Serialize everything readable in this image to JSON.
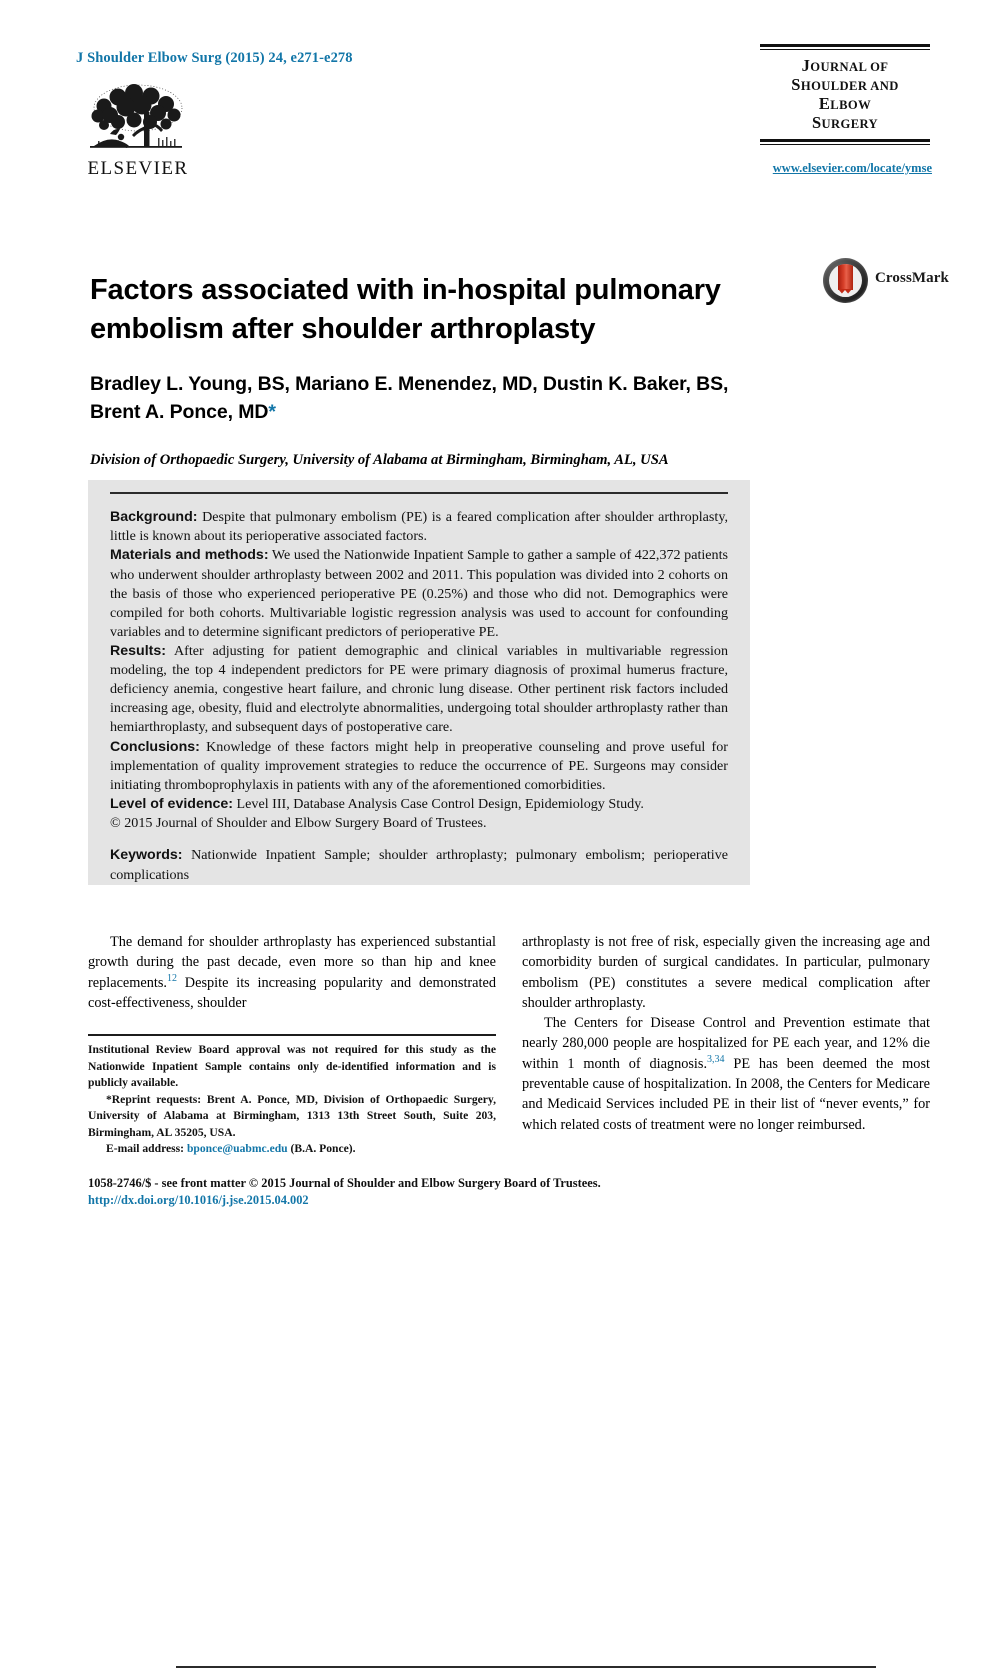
{
  "header": {
    "journal_ref": "J Shoulder Elbow Surg (2015) 24, e271-e278",
    "publisher_name": "ELSEVIER",
    "masthead": {
      "line1_first": "J",
      "line1_rest": "OURNAL OF",
      "line2_first": "S",
      "line2_rest": "HOULDER AND",
      "line3_first": "E",
      "line3_rest": "LBOW",
      "line4_first": "S",
      "line4_rest": "URGERY"
    },
    "journal_url": "www.elsevier.com/locate/ymse"
  },
  "article": {
    "title": "Factors associated with in-hospital pulmonary embolism after shoulder arthroplasty",
    "authors_line1": "Bradley L. Young, BS, Mariano E. Menendez, MD, Dustin K. Baker, BS,",
    "authors_line2": "Brent A. Ponce, MD",
    "corresponding_marker": "*",
    "affiliation": "Division of Orthopaedic Surgery, University of Alabama at Birmingham, Birmingham, AL, USA",
    "crossmark_label": "CrossMark"
  },
  "abstract": {
    "background_label": "Background:",
    "background_text": " Despite that pulmonary embolism (PE) is a feared complication after shoulder arthroplasty, little is known about its perioperative associated factors.",
    "methods_label": "Materials and methods:",
    "methods_text": " We used the Nationwide Inpatient Sample to gather a sample of 422,372 patients who underwent shoulder arthroplasty between 2002 and 2011. This population was divided into 2 cohorts on the basis of those who experienced perioperative PE (0.25%) and those who did not. Demographics were compiled for both cohorts. Multivariable logistic regression analysis was used to account for confounding variables and to determine significant predictors of perioperative PE.",
    "results_label": "Results:",
    "results_text": " After adjusting for patient demographic and clinical variables in multivariable regression modeling, the top 4 independent predictors for PE were primary diagnosis of proximal humerus fracture, deficiency anemia, congestive heart failure, and chronic lung disease. Other pertinent risk factors included increasing age, obesity, fluid and electrolyte abnormalities, undergoing total shoulder arthroplasty rather than hemiarthroplasty, and subsequent days of postoperative care.",
    "conclusions_label": "Conclusions:",
    "conclusions_text": " Knowledge of these factors might help in preoperative counseling and prove useful for implementation of quality improvement strategies to reduce the occurrence of PE. Surgeons may consider initiating thromboprophylaxis in patients with any of the aforementioned comorbidities.",
    "evidence_label": "Level of evidence:",
    "evidence_text": " Level III, Database Analysis Case Control Design, Epidemiology Study.",
    "copyright": "© 2015 Journal of Shoulder and Elbow Surgery Board of Trustees.",
    "keywords_label": "Keywords:",
    "keywords_text": " Nationwide Inpatient Sample; shoulder arthroplasty; pulmonary embolism; perioperative complications"
  },
  "body": {
    "left_col": {
      "para1_a": "The demand for shoulder arthroplasty has experienced substantial growth during the past decade, even more so than hip and knee replacements.",
      "para1_ref": "12",
      "para1_b": " Despite its increasing popularity and demonstrated cost-effectiveness, shoulder"
    },
    "right_col": {
      "para1": "arthroplasty is not free of risk, especially given the increasing age and comorbidity burden of surgical candidates. In particular, pulmonary embolism (PE) constitutes a severe medical complication after shoulder arthroplasty.",
      "para2_a": "The Centers for Disease Control and Prevention estimate that nearly 280,000 people are hospitalized for PE each year, and 12% die within 1 month of diagnosis.",
      "para2_ref": "3,34",
      "para2_b": " PE has been deemed the most preventable cause of hospitalization. In 2008, the Centers for Medicare and Medicaid Services included PE in their list of “never events,” for which related costs of treatment were no longer reimbursed."
    }
  },
  "footnote": {
    "irb": "Institutional Review Board approval was not required for this study as the Nationwide Inpatient Sample contains only de-identified information and is publicly available.",
    "reprint": "*Reprint requests: Brent A. Ponce, MD, Division of Orthopaedic Surgery, University of Alabama at Birmingham, 1313 13th Street South, Suite 203, Birmingham, AL 35205, USA.",
    "email_label": "E-mail address: ",
    "email": "bponce@uabmc.edu",
    "email_suffix": " (B.A. Ponce)."
  },
  "bottom": {
    "issn": "1058-2746/$ - see front matter © 2015 Journal of Shoulder and Elbow Surgery Board of Trustees.",
    "doi": "http://dx.doi.org/10.1016/j.jse.2015.04.002"
  },
  "colors": {
    "accent_blue": "#1276a8",
    "abstract_bg": "#e4e4e4",
    "rule_dark": "#2b2b2b"
  }
}
